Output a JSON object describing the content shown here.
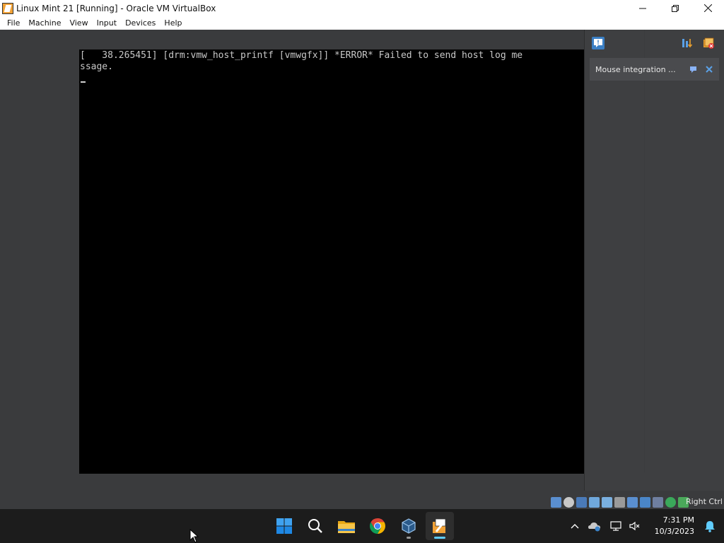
{
  "window": {
    "title": "Linux Mint 21 [Running] - Oracle VM VirtualBox"
  },
  "menu": {
    "items": [
      {
        "label": "File"
      },
      {
        "label": "Machine"
      },
      {
        "label": "View"
      },
      {
        "label": "Input"
      },
      {
        "label": "Devices"
      },
      {
        "label": "Help"
      }
    ]
  },
  "console": {
    "lines": [
      "[   38.265451] [drm:vmw_host_printf [vmwgfx]] *ERROR* Failed to send host log me",
      "ssage."
    ]
  },
  "notification_center": {
    "card_text": "Mouse integration ..."
  },
  "statusbar": {
    "host_key": "Right Ctrl"
  },
  "taskbar": {
    "time": "7:31 PM",
    "date": "10/3/2023",
    "apps": [
      {
        "icon": "windows-start-icon"
      },
      {
        "icon": "search-icon"
      },
      {
        "icon": "file-explorer-icon"
      },
      {
        "icon": "chrome-icon"
      },
      {
        "icon": "virtualbox-icon"
      },
      {
        "icon": "virtualbox-vm-icon"
      }
    ]
  },
  "colors": {
    "vm_background": "#3a3b3d",
    "console_background": "#000000",
    "console_text": "#c8c8c8",
    "taskbar": "#1c1c1c",
    "accent": "#60cdff"
  }
}
